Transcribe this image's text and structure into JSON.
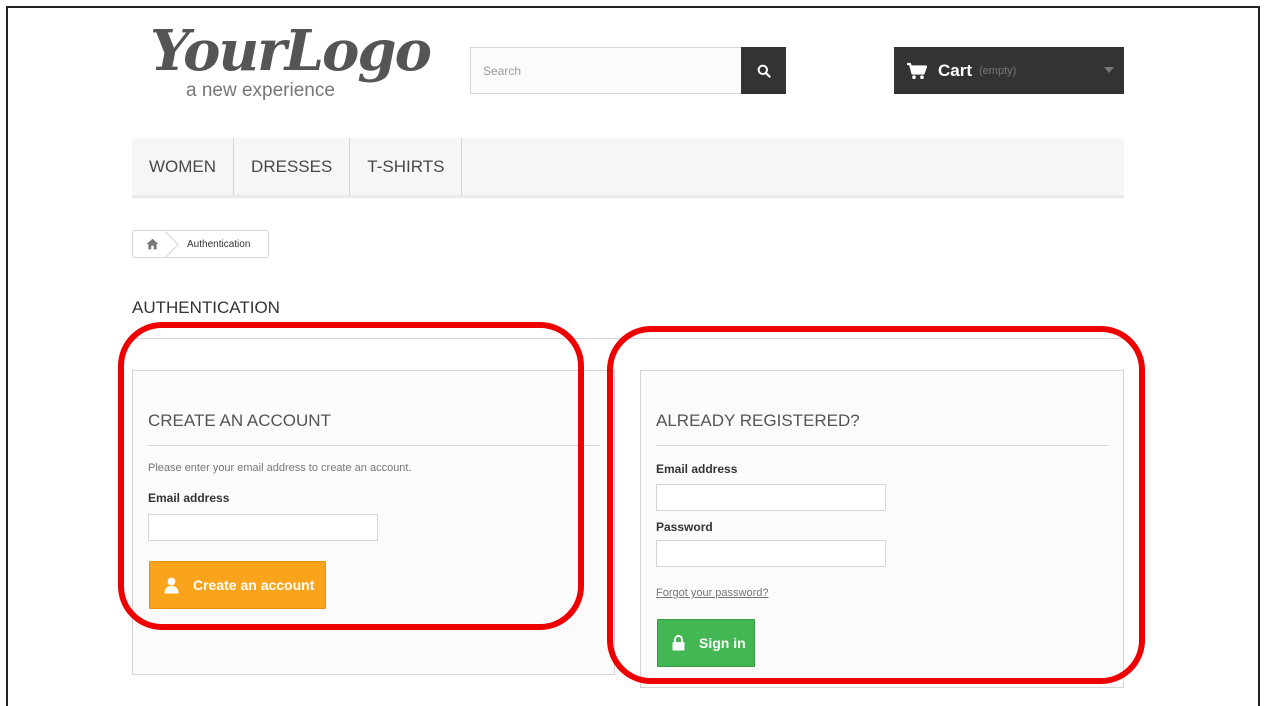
{
  "header": {
    "logo_main": "YourLogo",
    "logo_tagline": "a new experience",
    "search": {
      "placeholder": "Search"
    },
    "cart": {
      "label": "Cart",
      "status": "(empty)"
    }
  },
  "menu": {
    "items": [
      {
        "label": "WOMEN"
      },
      {
        "label": "DRESSES"
      },
      {
        "label": "T-SHIRTS"
      }
    ]
  },
  "breadcrumb": {
    "current": "Authentication"
  },
  "page": {
    "heading": "AUTHENTICATION"
  },
  "create_account": {
    "title": "CREATE AN ACCOUNT",
    "hint": "Please enter your email address to create an account.",
    "email_label": "Email address",
    "email_value": "",
    "button_label": "Create an account"
  },
  "login": {
    "title": "ALREADY REGISTERED?",
    "email_label": "Email address",
    "email_value": "",
    "password_label": "Password",
    "password_value": "",
    "forgot_label": "Forgot your password?",
    "button_label": "Sign in"
  },
  "colors": {
    "create_button": "#f9a41b",
    "signin_button": "#43b754",
    "dark": "#333333",
    "annotation": "#ee0000"
  }
}
